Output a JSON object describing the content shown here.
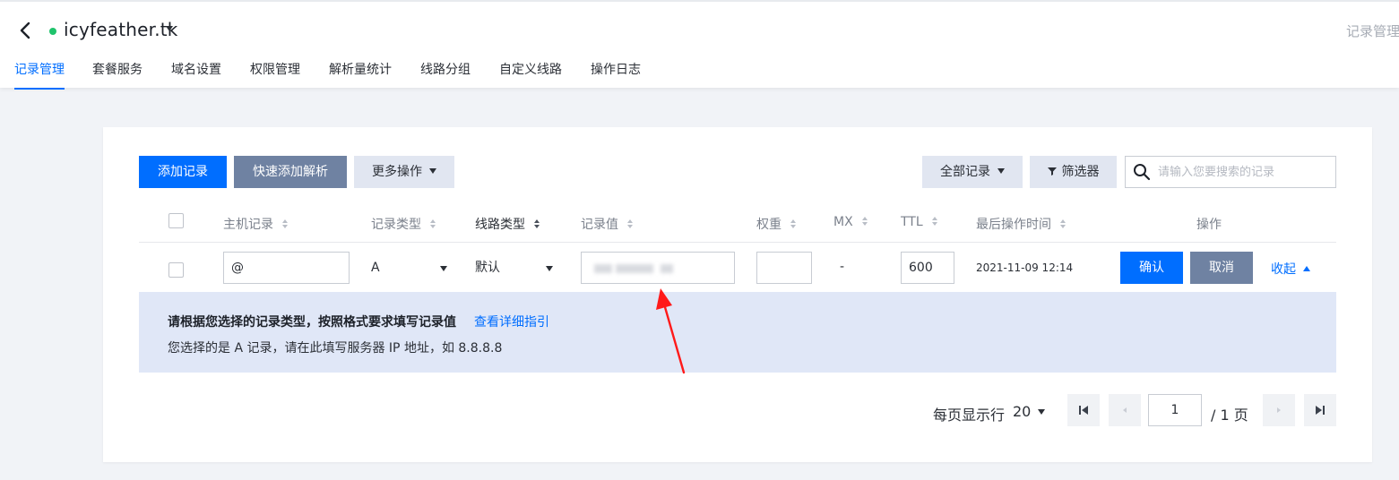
{
  "header": {
    "domain": "icyfeather.tk",
    "breadcrumb_right": "记录管理"
  },
  "tabs": [
    {
      "label": "记录管理",
      "active": true
    },
    {
      "label": "套餐服务"
    },
    {
      "label": "域名设置"
    },
    {
      "label": "权限管理"
    },
    {
      "label": "解析量统计"
    },
    {
      "label": "线路分组"
    },
    {
      "label": "自定义线路"
    },
    {
      "label": "操作日志"
    }
  ],
  "toolbar": {
    "add_record": "添加记录",
    "quick_add": "快速添加解析",
    "more_actions": "更多操作",
    "all_records": "全部记录",
    "filter": "筛选器",
    "search_placeholder": "请输入您要搜索的记录"
  },
  "table": {
    "headers": {
      "host": "主机记录",
      "type": "记录类型",
      "line": "线路类型",
      "value": "记录值",
      "weight": "权重",
      "mx": "MX",
      "ttl": "TTL",
      "last_modified": "最后操作时间",
      "actions": "操作"
    },
    "edit_row": {
      "host": "@",
      "type": "A",
      "line": "默认",
      "weight": "",
      "mx": "-",
      "ttl": "600",
      "last_modified": "2021-11-09 12:14",
      "confirm": "确认",
      "cancel": "取消",
      "collapse": "收起"
    }
  },
  "hint": {
    "title": "请根据您选择的记录类型，按照格式要求填写记录值",
    "link": "查看详细指引",
    "body": "您选择的是 A 记录，请在此填写服务器 IP 地址，如 8.8.8.8"
  },
  "pagination": {
    "rows_label": "每页显示行",
    "rows_per_page": "20",
    "current_page": "1",
    "total": "/ 1 页"
  },
  "colors": {
    "primary": "#006eff",
    "slate_button": "#6f82a2",
    "hint_bg": "#e0e7f7",
    "status_green": "#1fc36c",
    "annotation_red": "#ff1a1a"
  }
}
